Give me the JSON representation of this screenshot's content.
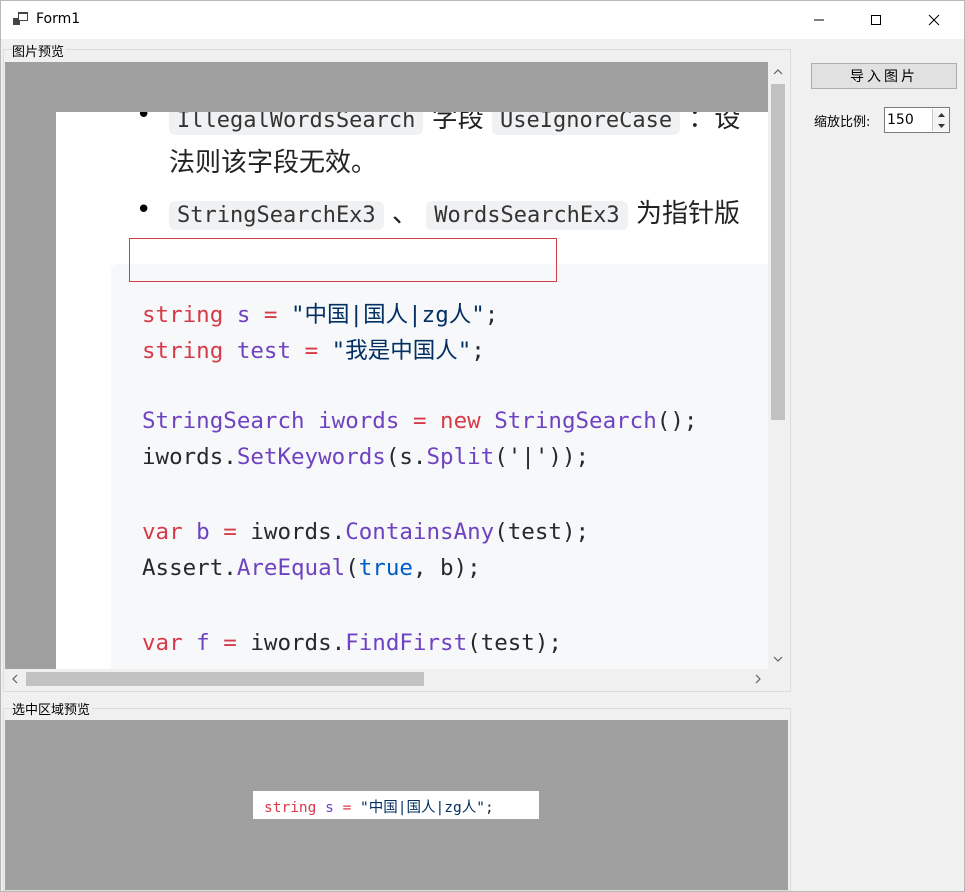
{
  "window": {
    "title": "Form1",
    "controls": {
      "minimize": "minimize-icon",
      "maximize": "maximize-icon",
      "close": "close-icon"
    }
  },
  "groups": {
    "image_preview": "图片预览",
    "selection_preview": "选中区域预览"
  },
  "toolbar": {
    "import_button": "导入图片",
    "scale_label": "缩放比例:",
    "scale_value": "150"
  },
  "document": {
    "line1_chip1": "IllegalWordsSearch",
    "line1_text1": "字段",
    "line1_chip2": "UseIgnoreCase",
    "line1_text2": "：设",
    "line2": "法则该字段无效。",
    "bullet2_chip1": "StringSearchEx3",
    "bullet2_sep": "、",
    "bullet2_chip2": "WordsSearchEx3",
    "bullet2_text": "为指针版"
  },
  "code": {
    "l1": {
      "kw": "string",
      "var": " s ",
      "op": "=",
      "str": " \"中国|国人|zg人\"",
      "end": ";"
    },
    "l2": {
      "kw": "string",
      "var": " test ",
      "op": "=",
      "str": " \"我是中国人\"",
      "end": ";"
    },
    "l3": {
      "type": "StringSearch",
      "var": " iwords ",
      "op": "=",
      "sp": " ",
      "new": "new",
      "sp2": " ",
      "ctor": "StringSearch",
      "end": "();"
    },
    "l4": {
      "obj": "iwords.",
      "m1": "SetKeywords",
      "mid": "(s.",
      "m2": "Split",
      "end": "('|'));"
    },
    "l5": {
      "kw": "var",
      "var": " b ",
      "op": "=",
      "obj": " iwords.",
      "m": "ContainsAny",
      "end": "(test);"
    },
    "l6": {
      "obj": "Assert.",
      "m": "AreEqual",
      "p1": "(",
      "bool": "true",
      "end": ", b);"
    },
    "l7": {
      "kw": "var",
      "var": " f ",
      "op": "=",
      "obj": " iwords.",
      "m": "FindFirst",
      "end": "(test);"
    }
  },
  "crop": {
    "kw": "string",
    "var": " s ",
    "op": "=",
    "str": " \"中国|国人|zg人\"",
    "end": ";"
  }
}
